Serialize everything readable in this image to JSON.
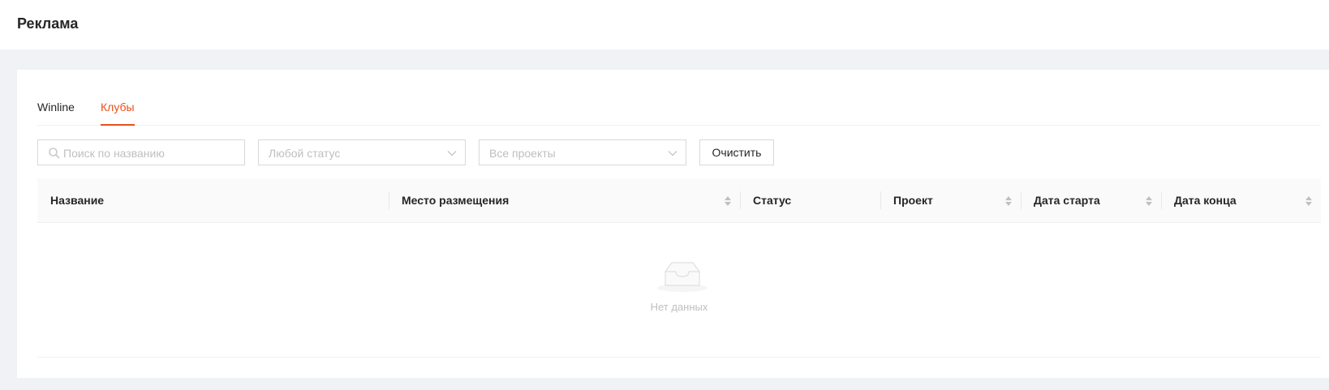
{
  "page": {
    "title": "Реклама"
  },
  "tabs": [
    {
      "label": "Winline",
      "active": false
    },
    {
      "label": "Клубы",
      "active": true
    }
  ],
  "filters": {
    "search_placeholder": "Поиск по названию",
    "status_placeholder": "Любой статус",
    "project_placeholder": "Все проекты",
    "clear_label": "Очистить"
  },
  "table": {
    "columns": [
      {
        "label": "Название",
        "sortable": false
      },
      {
        "label": "Место размещения",
        "sortable": true
      },
      {
        "label": "Статус",
        "sortable": false
      },
      {
        "label": "Проект",
        "sortable": true
      },
      {
        "label": "Дата старта",
        "sortable": true
      },
      {
        "label": "Дата конца",
        "sortable": true
      }
    ],
    "empty_text": "Нет данных"
  },
  "colors": {
    "accent": "#e8501a",
    "background": "#f0f2f5"
  }
}
